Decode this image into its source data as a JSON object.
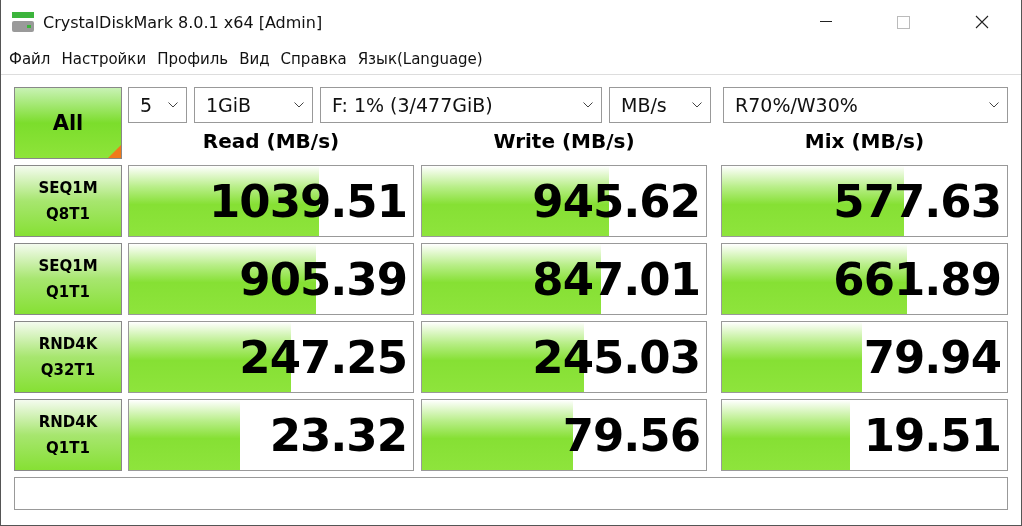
{
  "window": {
    "title": "CrystalDiskMark 8.0.1 x64 [Admin]"
  },
  "menu": [
    "Файл",
    "Настройки",
    "Профиль",
    "Вид",
    "Справка",
    "Язык(Language)"
  ],
  "all_button": {
    "label": "All"
  },
  "selects": [
    {
      "value": "5"
    },
    {
      "value": "1GiB"
    },
    {
      "value": "F: 1% (3/477GiB)"
    },
    {
      "value": "MB/s"
    },
    {
      "value": "R70%/W30%"
    }
  ],
  "columns": [
    "Read (MB/s)",
    "Write (MB/s)",
    "Mix (MB/s)"
  ],
  "rows": [
    {
      "test": [
        "SEQ1M",
        "Q8T1"
      ],
      "results": [
        {
          "value": "1039.51",
          "level": 0.67
        },
        {
          "value": "945.62",
          "level": 0.66
        },
        {
          "value": "577.63",
          "level": 0.64
        }
      ]
    },
    {
      "test": [
        "SEQ1M",
        "Q1T1"
      ],
      "results": [
        {
          "value": "905.39",
          "level": 0.66
        },
        {
          "value": "847.01",
          "level": 0.63
        },
        {
          "value": "661.89",
          "level": 0.65
        }
      ]
    },
    {
      "test": [
        "RND4K",
        "Q32T1"
      ],
      "results": [
        {
          "value": "247.25",
          "level": 0.57
        },
        {
          "value": "245.03",
          "level": 0.57
        },
        {
          "value": "79.94",
          "level": 0.49
        }
      ]
    },
    {
      "test": [
        "RND4K",
        "Q1T1"
      ],
      "results": [
        {
          "value": "23.32",
          "level": 0.39
        },
        {
          "value": "79.56",
          "level": 0.53
        },
        {
          "value": "19.51",
          "level": 0.45
        }
      ]
    }
  ]
}
